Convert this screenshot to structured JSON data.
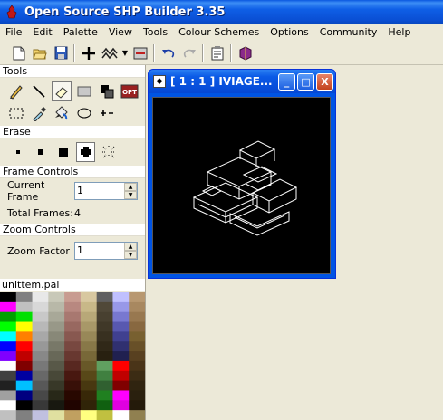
{
  "app": {
    "title": "Open Source SHP Builder 3.35"
  },
  "menu": [
    "File",
    "Edit",
    "Palette",
    "View",
    "Tools",
    "Colour Schemes",
    "Options",
    "Community",
    "Help"
  ],
  "toolbar": {
    "icons": [
      "new-file-icon",
      "open-folder-icon",
      "save-icon",
      "crosshair-icon",
      "pattern-icon",
      "dropdown-arrow-icon",
      "preview-icon",
      "undo-icon",
      "redo-icon",
      "properties-icon",
      "book-icon"
    ]
  },
  "panel": {
    "tools_label": "Tools",
    "tools": [
      "pencil",
      "line",
      "eraser",
      "rectangle",
      "dark-light",
      "opt",
      "select-rect",
      "eyedropper",
      "fill",
      "ellipse",
      "move"
    ],
    "opt_label": "OPT",
    "erase_label": "Erase",
    "frame_controls_label": "Frame Controls",
    "current_frame_label": "Current Frame",
    "current_frame_value": "1",
    "total_frames_label": "Total Frames:",
    "total_frames_value": "4",
    "zoom_controls_label": "Zoom Controls",
    "zoom_factor_label": "Zoom Factor",
    "zoom_factor_value": "1",
    "palette_name": "unittem.pal"
  },
  "child_window": {
    "title": "[ 1 : 1 ] IVIAGE...",
    "minimize": "_",
    "maximize": "□",
    "close": "X"
  },
  "palette_colors": [
    [
      "#000000",
      "#808080",
      "#e8e8e8",
      "#c8c8b8",
      "#c89c90",
      "#d8c8a0",
      "#606060",
      "#c0c0ff",
      "#b89870"
    ],
    [
      "#ff00ff",
      "#c0c0c0",
      "#d8d8d8",
      "#b8b8a8",
      "#b88880",
      "#c8b888",
      "#504838",
      "#9898e8",
      "#a88860"
    ],
    [
      "#00a000",
      "#00e000",
      "#c8c8c8",
      "#a8a898",
      "#a87870",
      "#b8a878",
      "#484030",
      "#7878d0",
      "#987850"
    ],
    [
      "#00ff00",
      "#ffff00",
      "#b8b8b8",
      "#989888",
      "#986860",
      "#a89868",
      "#403828",
      "#5858b0",
      "#886840"
    ],
    [
      "#00ffff",
      "#ff8000",
      "#a8a8a8",
      "#888878",
      "#885850",
      "#988858",
      "#383020",
      "#404090",
      "#786030"
    ],
    [
      "#0000ff",
      "#ff0000",
      "#989898",
      "#787868",
      "#784840",
      "#887848",
      "#302818",
      "#303070",
      "#685028"
    ],
    [
      "#8000ff",
      "#c00000",
      "#888888",
      "#686858",
      "#683830",
      "#786838",
      "#282010",
      "#202050",
      "#584020"
    ],
    [
      "#ffffff",
      "#800000",
      "#787878",
      "#585848",
      "#582820",
      "#685828",
      "#60a060",
      "#ff0000",
      "#4a3418"
    ],
    [
      "#404040",
      "#0000a0",
      "#686868",
      "#484838",
      "#481810",
      "#584818",
      "#408040",
      "#c00000",
      "#3c2c14"
    ],
    [
      "#202020",
      "#00c0ff",
      "#585858",
      "#383828",
      "#381008",
      "#483810",
      "#306030",
      "#800000",
      "#302410"
    ],
    [
      "#a0a0a0",
      "#000080",
      "#484848",
      "#282818",
      "#280800",
      "#382808",
      "#208020",
      "#ff00ff",
      "#2a200e"
    ],
    [
      "#ffffff",
      "#000000",
      "#383838",
      "#181810",
      "#200400",
      "#302408",
      "#106010",
      "#e000e0",
      "#241a0a"
    ],
    [
      "#c0c0c0",
      "#808080",
      "#c0c0e0",
      "#e0e0a0",
      "#c0a060",
      "#ffff80",
      "#c0c040",
      "#ffffff",
      "#908050"
    ]
  ]
}
